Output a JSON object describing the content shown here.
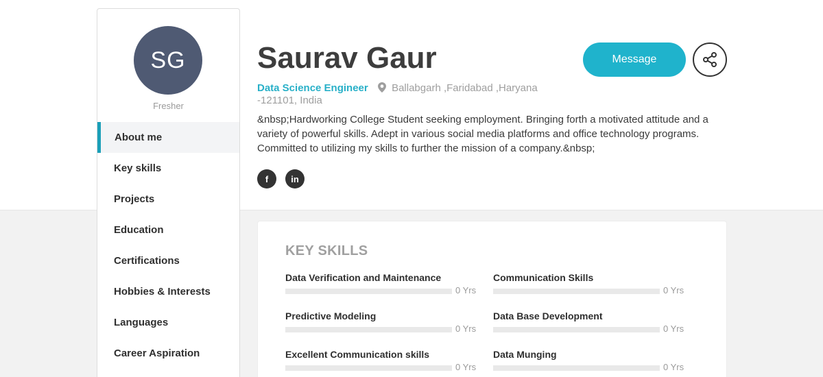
{
  "profile": {
    "initials": "SG",
    "status": "Fresher",
    "name": "Saurav Gaur",
    "job_title": "Data Science Engineer",
    "location": "Ballabgarh ,Faridabad ,Haryana -121101, India",
    "summary": "&nbsp;Hardworking College Student seeking employment. Bringing forth a motivated attitude and a variety of powerful skills. Adept in various social media platforms and office technology programs. Committed to utilizing my skills to further the mission of a company.&nbsp;",
    "avatar_color": "#4f5a73"
  },
  "actions": {
    "message_label": "Message",
    "accent_color": "#1fb3cc",
    "share_icon": "share-icon"
  },
  "socials": [
    {
      "label": "f",
      "icon": "facebook-icon"
    },
    {
      "label": "in",
      "icon": "linkedin-icon"
    }
  ],
  "sidebar": {
    "items": [
      {
        "label": "About me",
        "active": true
      },
      {
        "label": "Key skills",
        "active": false
      },
      {
        "label": "Projects",
        "active": false
      },
      {
        "label": "Education",
        "active": false
      },
      {
        "label": "Certifications",
        "active": false
      },
      {
        "label": "Hobbies & Interests",
        "active": false
      },
      {
        "label": "Languages",
        "active": false
      },
      {
        "label": "Career Aspiration",
        "active": false
      }
    ]
  },
  "key_skills": {
    "title": "KEY SKILLS",
    "items": [
      {
        "name": "Data Verification and Maintenance",
        "years": "0 Yrs",
        "level": 0
      },
      {
        "name": "Communication Skills",
        "years": "0 Yrs",
        "level": 0
      },
      {
        "name": "Predictive Modeling",
        "years": "0 Yrs",
        "level": 0
      },
      {
        "name": "Data Base Development",
        "years": "0 Yrs",
        "level": 0
      },
      {
        "name": "Excellent Communication skills",
        "years": "0 Yrs",
        "level": 0
      },
      {
        "name": "Data Munging",
        "years": "0 Yrs",
        "level": 0
      }
    ]
  }
}
